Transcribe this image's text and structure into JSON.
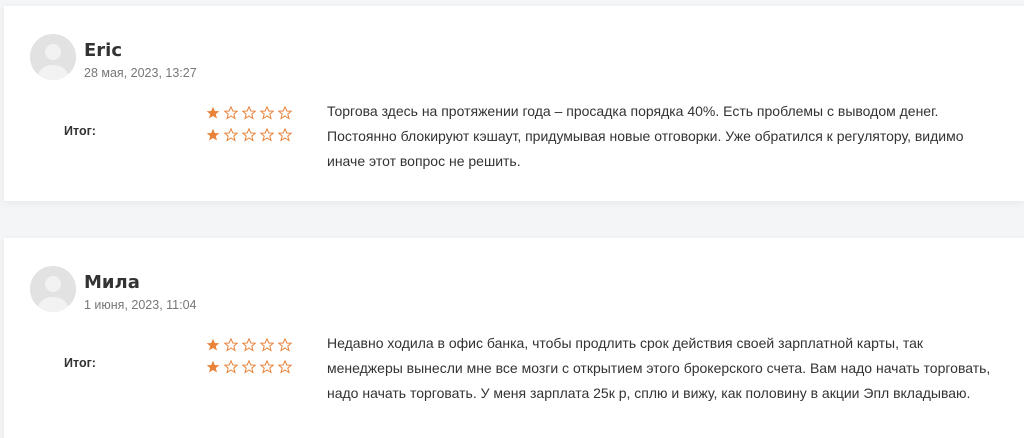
{
  "colors": {
    "star_filled": "#e8833a",
    "star_empty": "#e8833a",
    "avatar_bg": "#e2e2e2",
    "text": "#333333",
    "date": "#777777"
  },
  "reviews": [
    {
      "author": "Eric",
      "date": "28 мая, 2023, 13:27",
      "total_label": "Итог:",
      "ratings": [
        1,
        1
      ],
      "max_rating": 5,
      "text": "Торгова здесь на протяжении года – просадка порядка 40%. Есть проблемы с выводом денег. Постоянно блокируют кэшаут, придумывая новые отговорки. Уже обратился к регулятору, видимо иначе этот вопрос не решить."
    },
    {
      "author": "Мила",
      "date": "1 июня, 2023, 11:04",
      "total_label": "Итог:",
      "ratings": [
        1,
        1
      ],
      "max_rating": 5,
      "text": "Недавно ходила в офис банка, чтобы продлить срок действия своей зарплатной карты, так менеджеры вынесли мне все мозги с открытием этого брокерского счета. Вам надо начать торговать, надо начать торговать. У меня зарплата 25к р, сплю и вижу, как половину в акции Эпл вкладываю."
    }
  ]
}
